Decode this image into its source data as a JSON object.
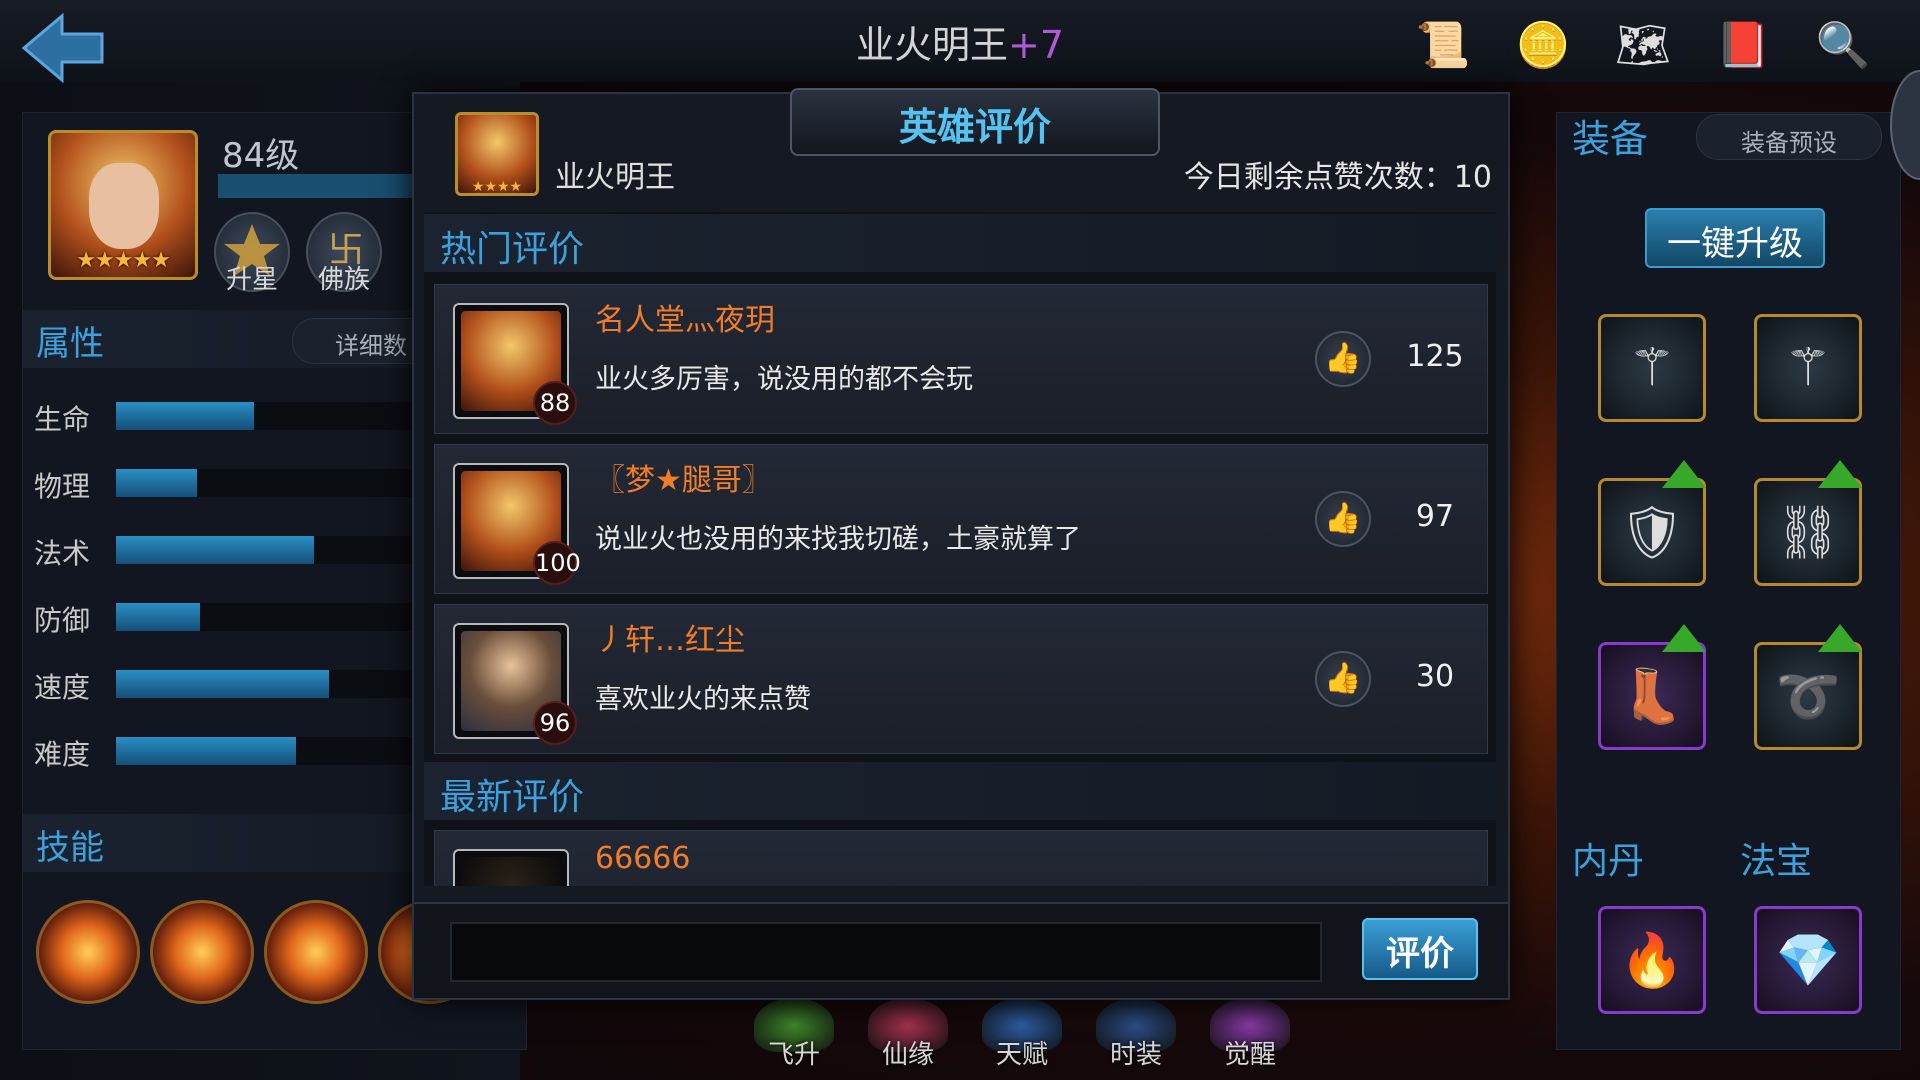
{
  "header": {
    "hero_name": "业火明王",
    "plus": "+7",
    "tools": [
      {
        "icon": "scroll-icon",
        "glyph": "📜"
      },
      {
        "icon": "coin-icon",
        "glyph": "🪙"
      },
      {
        "icon": "map-icon",
        "glyph": "🗺"
      },
      {
        "icon": "book-icon",
        "glyph": "📕"
      },
      {
        "icon": "magnifier-icon",
        "glyph": "🔍"
      }
    ]
  },
  "left_panel": {
    "level": "84级",
    "stars": "★★★★★",
    "buttons": [
      {
        "label": "升星"
      },
      {
        "label": "佛族"
      }
    ],
    "attributes_title": "属性",
    "detail_button": "详细数",
    "stats": [
      {
        "label": "生命",
        "value": 0.46
      },
      {
        "label": "物理",
        "value": 0.27
      },
      {
        "label": "法术",
        "value": 0.66
      },
      {
        "label": "防御",
        "value": 0.28
      },
      {
        "label": "速度",
        "value": 0.71
      },
      {
        "label": "难度",
        "value": 0.6
      }
    ],
    "skills_title": "技能"
  },
  "right_panel": {
    "equipment_title": "装备",
    "preset_button": "装备预设",
    "upgrade_button": "一键升级",
    "items": [
      {
        "icon": "staff-icon",
        "glyph": "⚚",
        "frame": "gold",
        "upgrade": false
      },
      {
        "icon": "staff-icon",
        "glyph": "⚚",
        "frame": "gold",
        "upgrade": false
      },
      {
        "icon": "armor-icon",
        "glyph": "🛡",
        "frame": "gold",
        "upgrade": true
      },
      {
        "icon": "bracer-icon",
        "glyph": "⛓",
        "frame": "gold",
        "upgrade": true
      },
      {
        "icon": "boot-icon",
        "glyph": "👢",
        "frame": "purple",
        "upgrade": true
      },
      {
        "icon": "ring-icon",
        "glyph": "➰",
        "frame": "gold",
        "upgrade": true
      }
    ],
    "inner_pill_title": "内丹",
    "treasure_title": "法宝",
    "inner_pill_item": {
      "icon": "fireball-icon",
      "glyph": "🔥"
    },
    "treasure_item": {
      "icon": "crystal-icon",
      "glyph": "💎"
    }
  },
  "bottom_tabs": [
    {
      "label": "飞升",
      "color": "#3f8a2a"
    },
    {
      "label": "仙缘",
      "color": "#a8324f"
    },
    {
      "label": "天赋",
      "color": "#2d5fa8"
    },
    {
      "label": "时装",
      "color": "#2d4f8a"
    },
    {
      "label": "觉醒",
      "color": "#8a3aa8"
    }
  ],
  "dialog": {
    "title": "英雄评价",
    "hero_name": "业火明王",
    "hero_stars": "★★★★",
    "likes_remaining": "今日剩余点赞次数：10",
    "hot_title": "热门评价",
    "hot_reviews": [
      {
        "name": "名人堂灬夜玥",
        "level": "88",
        "text": "业火多厉害，说没用的都不会玩",
        "likes": "125",
        "avatar": "fire"
      },
      {
        "name": "〖梦★腿哥〗",
        "level": "100",
        "text": "说业火也没用的来找我切磋，土豪就算了",
        "likes": "97",
        "avatar": "fire"
      },
      {
        "name": "丿轩…红尘",
        "level": "96",
        "text": "喜欢业火的来点赞",
        "likes": "30",
        "avatar": "blue"
      }
    ],
    "new_title": "最新评价",
    "new_reviews": [
      {
        "name": "66666",
        "avatar": "dark"
      }
    ],
    "input_placeholder": "",
    "submit_button": "评价"
  }
}
